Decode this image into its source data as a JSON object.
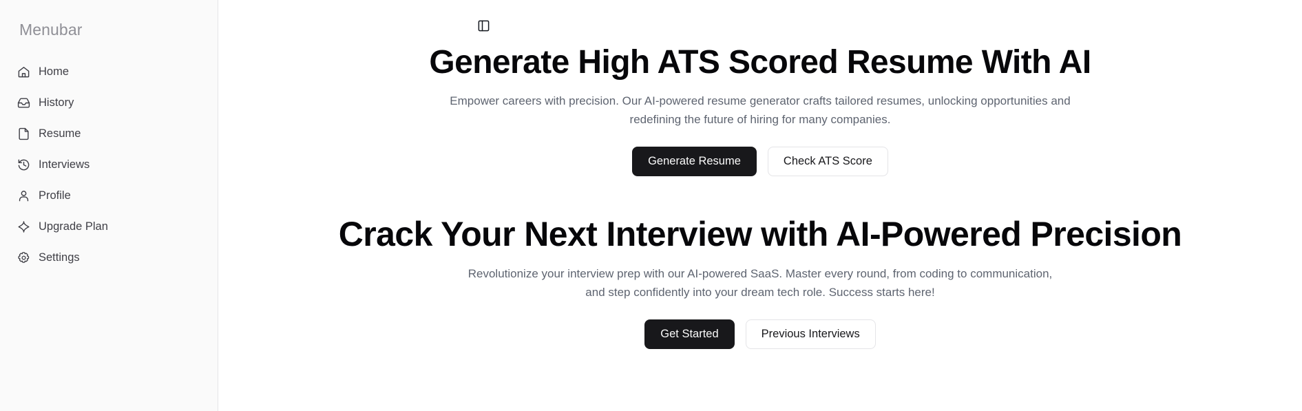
{
  "sidebar": {
    "title": "Menubar",
    "items": [
      {
        "label": "Home",
        "icon": "home-icon"
      },
      {
        "label": "History",
        "icon": "inbox-icon"
      },
      {
        "label": "Resume",
        "icon": "file-icon"
      },
      {
        "label": "Interviews",
        "icon": "history-clock-icon"
      },
      {
        "label": "Profile",
        "icon": "user-icon"
      },
      {
        "label": "Upgrade Plan",
        "icon": "sparkle-icon"
      },
      {
        "label": "Settings",
        "icon": "gear-icon"
      }
    ],
    "background_color": "#fafafa",
    "border_color": "#e4e4e7",
    "title_color": "#8f8f96"
  },
  "main": {
    "panel_toggle_icon": "panel-left-icon",
    "sections": [
      {
        "title": "Generate High ATS Scored Resume With AI",
        "subtitle": "Empower careers with precision. Our AI-powered resume generator crafts tailored resumes, unlocking opportunities and redefining the future of hiring for many companies.",
        "primary_button": "Generate Resume",
        "secondary_button": "Check ATS Score"
      },
      {
        "title": "Crack Your Next Interview with AI-Powered Precision",
        "subtitle": "Revolutionize your interview prep with our AI-powered SaaS. Master every round, from coding to communication, and step confidently into your dream tech role. Success starts here!",
        "primary_button": "Get Started",
        "secondary_button": "Previous Interviews"
      }
    ],
    "colors": {
      "heading": "#07070a",
      "subtitle": "#5e6470",
      "primary_button_bg": "#18181b",
      "primary_button_text": "#fafafa",
      "secondary_button_bg": "#ffffff",
      "secondary_button_text": "#18181b",
      "secondary_button_border": "#e4e4e7"
    }
  }
}
